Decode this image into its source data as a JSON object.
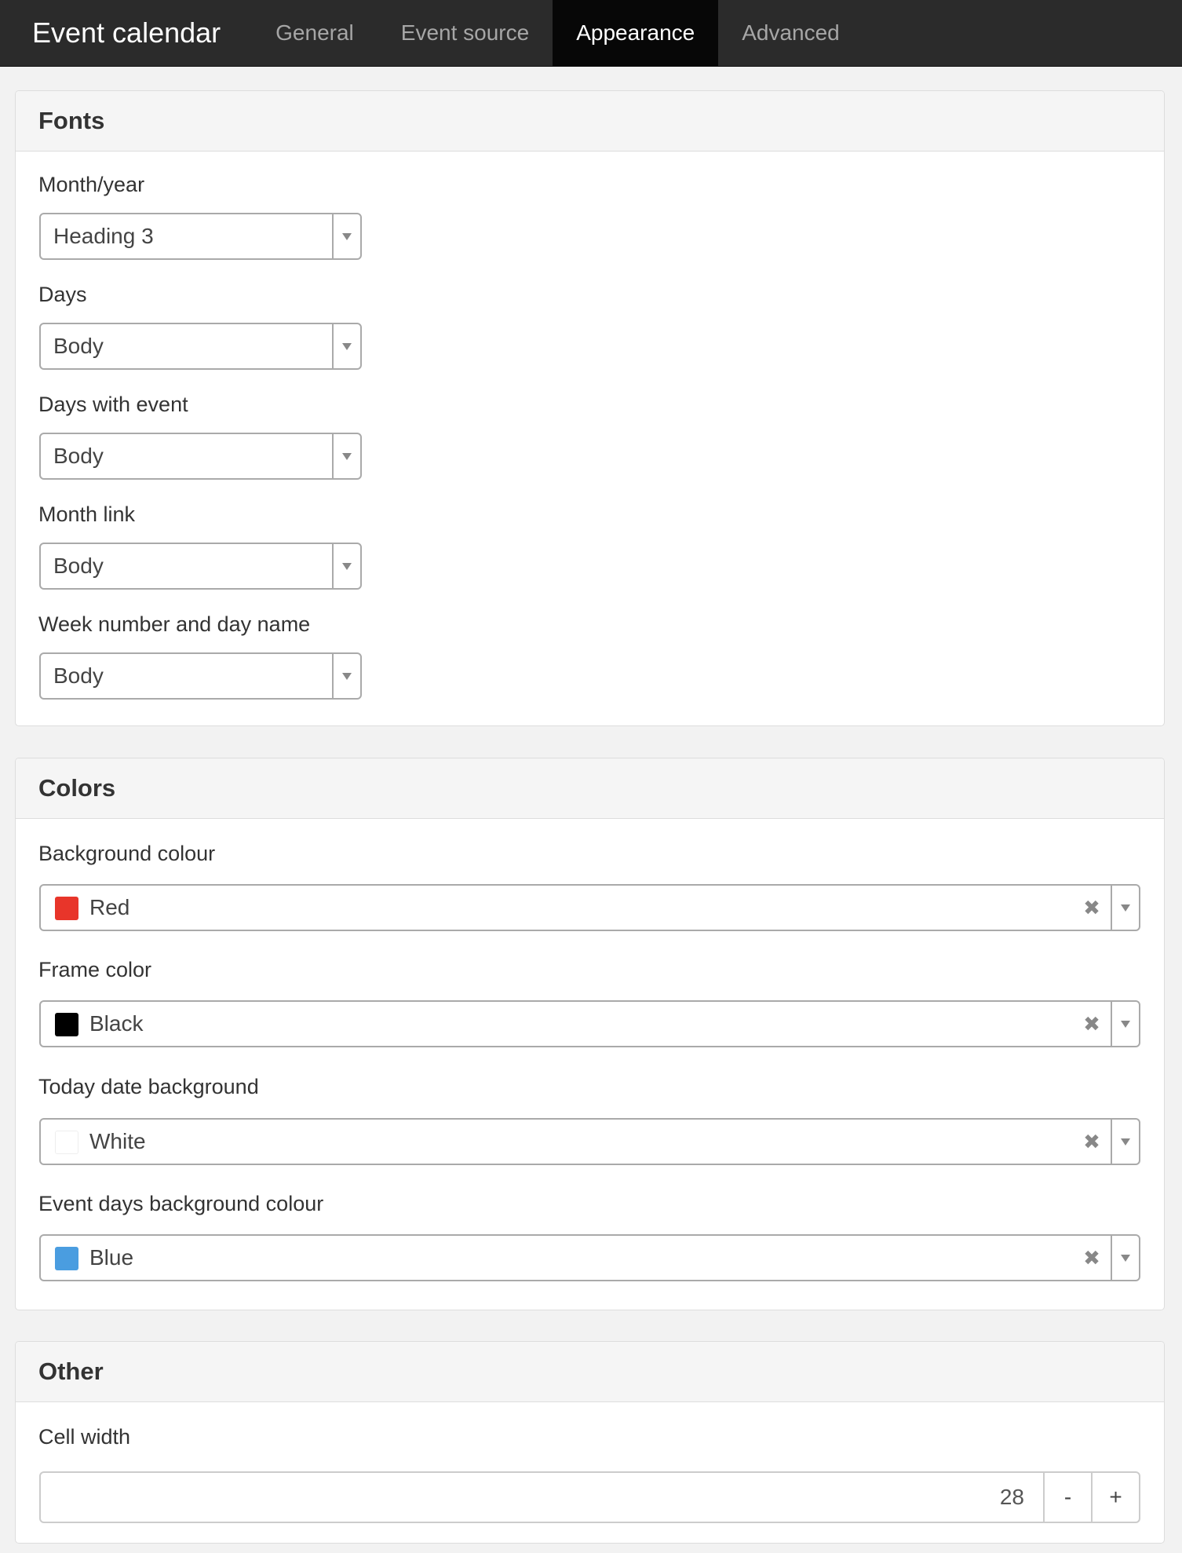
{
  "app": {
    "title": "Event calendar",
    "tabs": [
      {
        "label": "General",
        "active": false
      },
      {
        "label": "Event source",
        "active": false
      },
      {
        "label": "Appearance",
        "active": true
      },
      {
        "label": "Advanced",
        "active": false
      }
    ]
  },
  "fonts": {
    "heading": "Fonts",
    "fields": [
      {
        "label": "Month/year",
        "value": "Heading 3"
      },
      {
        "label": "Days",
        "value": "Body"
      },
      {
        "label": "Days with event",
        "value": "Body"
      },
      {
        "label": "Month link",
        "value": "Body"
      },
      {
        "label": "Week number and day name",
        "value": "Body"
      }
    ]
  },
  "colors": {
    "heading": "Colors",
    "clear_glyph": "✖",
    "fields": [
      {
        "label": "Background colour",
        "value": "Red",
        "swatch": "#e8352a"
      },
      {
        "label": "Frame color",
        "value": "Black",
        "swatch": "#000000"
      },
      {
        "label": "Today date background",
        "value": "White",
        "swatch": "#ffffff"
      },
      {
        "label": "Event days background colour",
        "value": "Blue",
        "swatch": "#4a9de0"
      }
    ]
  },
  "other": {
    "heading": "Other",
    "cell_width": {
      "label": "Cell width",
      "value": "28",
      "decrement": "-",
      "increment": "+"
    }
  }
}
